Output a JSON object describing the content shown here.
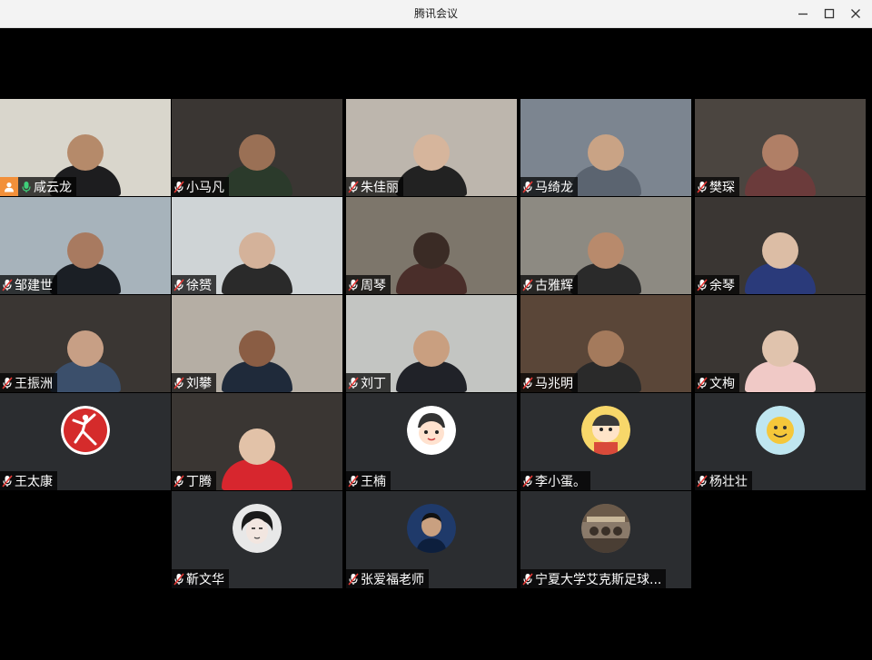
{
  "window": {
    "title": "腾讯会议"
  },
  "participants": [
    {
      "name": "咸云龙",
      "host": true,
      "mic": "on",
      "kind": "video",
      "bg": "#d9d6cc",
      "skin": "#b58a6a",
      "cloth": "#1d1d1f",
      "active": true
    },
    {
      "name": "小马凡",
      "mic": "off",
      "kind": "video",
      "bg": "#3a3633",
      "skin": "#9a7055",
      "cloth": "#2b3a2b"
    },
    {
      "name": "朱佳丽",
      "mic": "off",
      "kind": "video",
      "bg": "#bdb6ad",
      "skin": "#d6b59c",
      "cloth": "#222222"
    },
    {
      "name": "马绮龙",
      "mic": "off",
      "kind": "video",
      "bg": "#7c8590",
      "skin": "#c9a385",
      "cloth": "#5b6470"
    },
    {
      "name": "樊琛",
      "mic": "off",
      "kind": "video",
      "bg": "#4b4540",
      "skin": "#b07f66",
      "cloth": "#6b3b3b"
    },
    {
      "name": "邹建世",
      "mic": "off",
      "kind": "video",
      "bg": "#a7b3bb",
      "skin": "#a87a60",
      "cloth": "#1b1f25"
    },
    {
      "name": "徐赟",
      "mic": "off",
      "kind": "video",
      "bg": "#cfd4d6",
      "skin": "#d4b29a",
      "cloth": "#2a2a2a"
    },
    {
      "name": "周琴",
      "mic": "off",
      "kind": "video",
      "bg": "#7d766b",
      "skin": "#3a2b25",
      "cloth": "#4a2e2a"
    },
    {
      "name": "古雅辉",
      "mic": "off",
      "kind": "video",
      "bg": "#8d8a82",
      "skin": "#b88a6c",
      "cloth": "#2a2a2a"
    },
    {
      "name": "余琴",
      "mic": "off",
      "kind": "video",
      "bg": "#3a3633",
      "skin": "#dcbda5",
      "cloth": "#2a3a7a"
    },
    {
      "name": "王振洲",
      "mic": "off",
      "kind": "video",
      "bg": "#3a3633",
      "skin": "#c79f85",
      "cloth": "#3b4f6b"
    },
    {
      "name": "刘攀",
      "mic": "off",
      "kind": "video",
      "bg": "#b5aea4",
      "skin": "#8a5d44",
      "cloth": "#1f2a3a"
    },
    {
      "name": "刘丁",
      "mic": "off",
      "kind": "video",
      "bg": "#c3c5c2",
      "skin": "#c99f80",
      "cloth": "#202228"
    },
    {
      "name": "马兆明",
      "mic": "off",
      "kind": "video",
      "bg": "#5a4638",
      "skin": "#a47a5c",
      "cloth": "#2a2a2a"
    },
    {
      "name": "文栒",
      "mic": "off",
      "kind": "video",
      "bg": "#3a3633",
      "skin": "#e0c3ad",
      "cloth": "#f0c9c6"
    },
    {
      "name": "王太康",
      "mic": "off",
      "kind": "avatar",
      "avatar_style": "jumpman",
      "avatar_bg": "#ffffff",
      "avatar_fg": "#d52b2b"
    },
    {
      "name": "丁腾",
      "mic": "off",
      "kind": "video",
      "bg": "#3a3633",
      "skin": "#e2c2a8",
      "cloth": "#d7262e"
    },
    {
      "name": "王楠",
      "mic": "off",
      "kind": "avatar",
      "avatar_style": "cartoon-boy",
      "avatar_bg": "#ffffff",
      "avatar_fg": "#333333"
    },
    {
      "name": "李小蛋。",
      "mic": "off",
      "kind": "avatar",
      "avatar_style": "cartoon-kid",
      "avatar_bg": "#f7d76a",
      "avatar_fg": "#3a3a3a"
    },
    {
      "name": "杨壮壮",
      "mic": "off",
      "kind": "avatar",
      "avatar_style": "smiley",
      "avatar_bg": "#bfe6f0",
      "avatar_fg": "#f5c73a"
    },
    {
      "name": "靳文华",
      "mic": "off",
      "kind": "avatar",
      "avatar_style": "portrait-bw",
      "avatar_bg": "#e8e8e8",
      "avatar_fg": "#1a1a1a"
    },
    {
      "name": "张爱福老师",
      "mic": "off",
      "kind": "avatar",
      "avatar_style": "portrait-kid",
      "avatar_bg": "#1f3a6a",
      "avatar_fg": "#c9a080"
    },
    {
      "name": "宁夏大学艾克斯足球...",
      "mic": "off",
      "kind": "avatar",
      "avatar_style": "photo-room",
      "avatar_bg": "#8a7a6a",
      "avatar_fg": "#3a3028"
    }
  ]
}
